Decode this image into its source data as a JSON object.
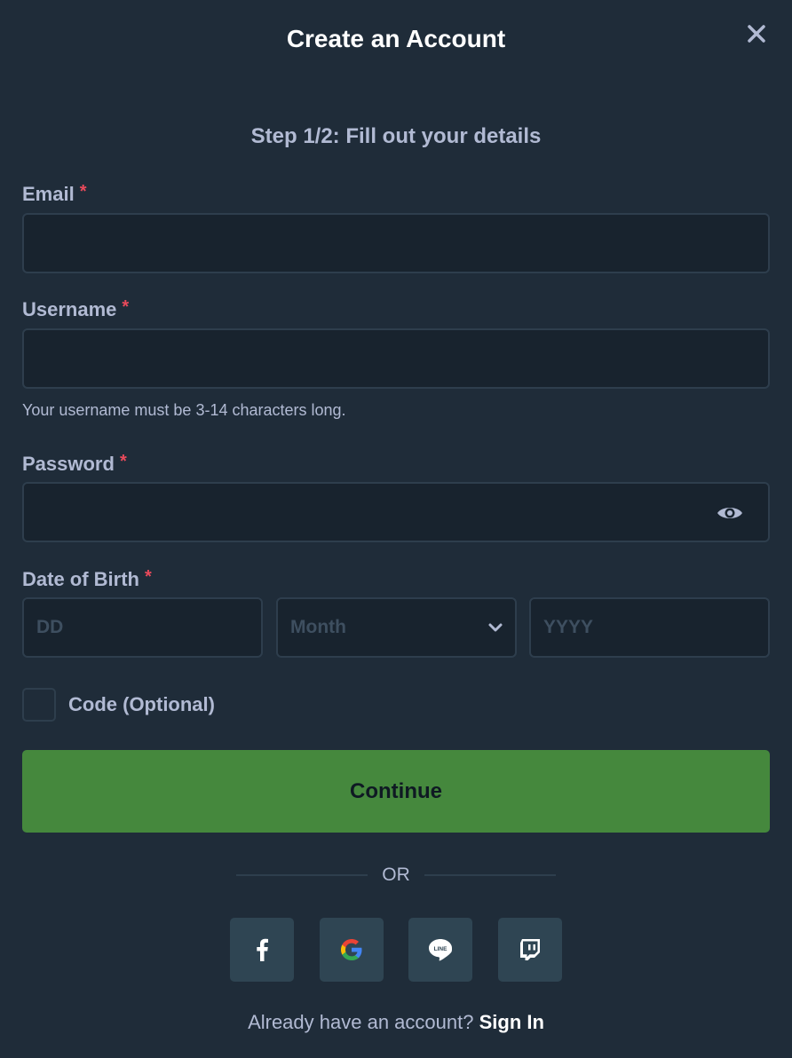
{
  "modal": {
    "title": "Create an Account",
    "step": "Step 1/2: Fill out your details"
  },
  "form": {
    "email_label": "Email",
    "username_label": "Username",
    "username_hint": "Your username must be 3-14 characters long.",
    "password_label": "Password",
    "dob_label": "Date of Birth",
    "required_mark": "*",
    "dob": {
      "day_placeholder": "DD",
      "month_placeholder": "Month",
      "year_placeholder": "YYYY"
    },
    "code_label": "Code (Optional)",
    "continue_label": "Continue"
  },
  "divider": {
    "text": "OR"
  },
  "social": [
    "facebook-icon",
    "google-icon",
    "line-icon",
    "twitch-icon"
  ],
  "footer": {
    "prompt": "Already have an account?",
    "signin_label": "Sign In"
  },
  "colors": {
    "background": "#1f2c39",
    "input_bg": "#18232e",
    "button_green": "#45883d",
    "required_red": "#e94a5b"
  }
}
